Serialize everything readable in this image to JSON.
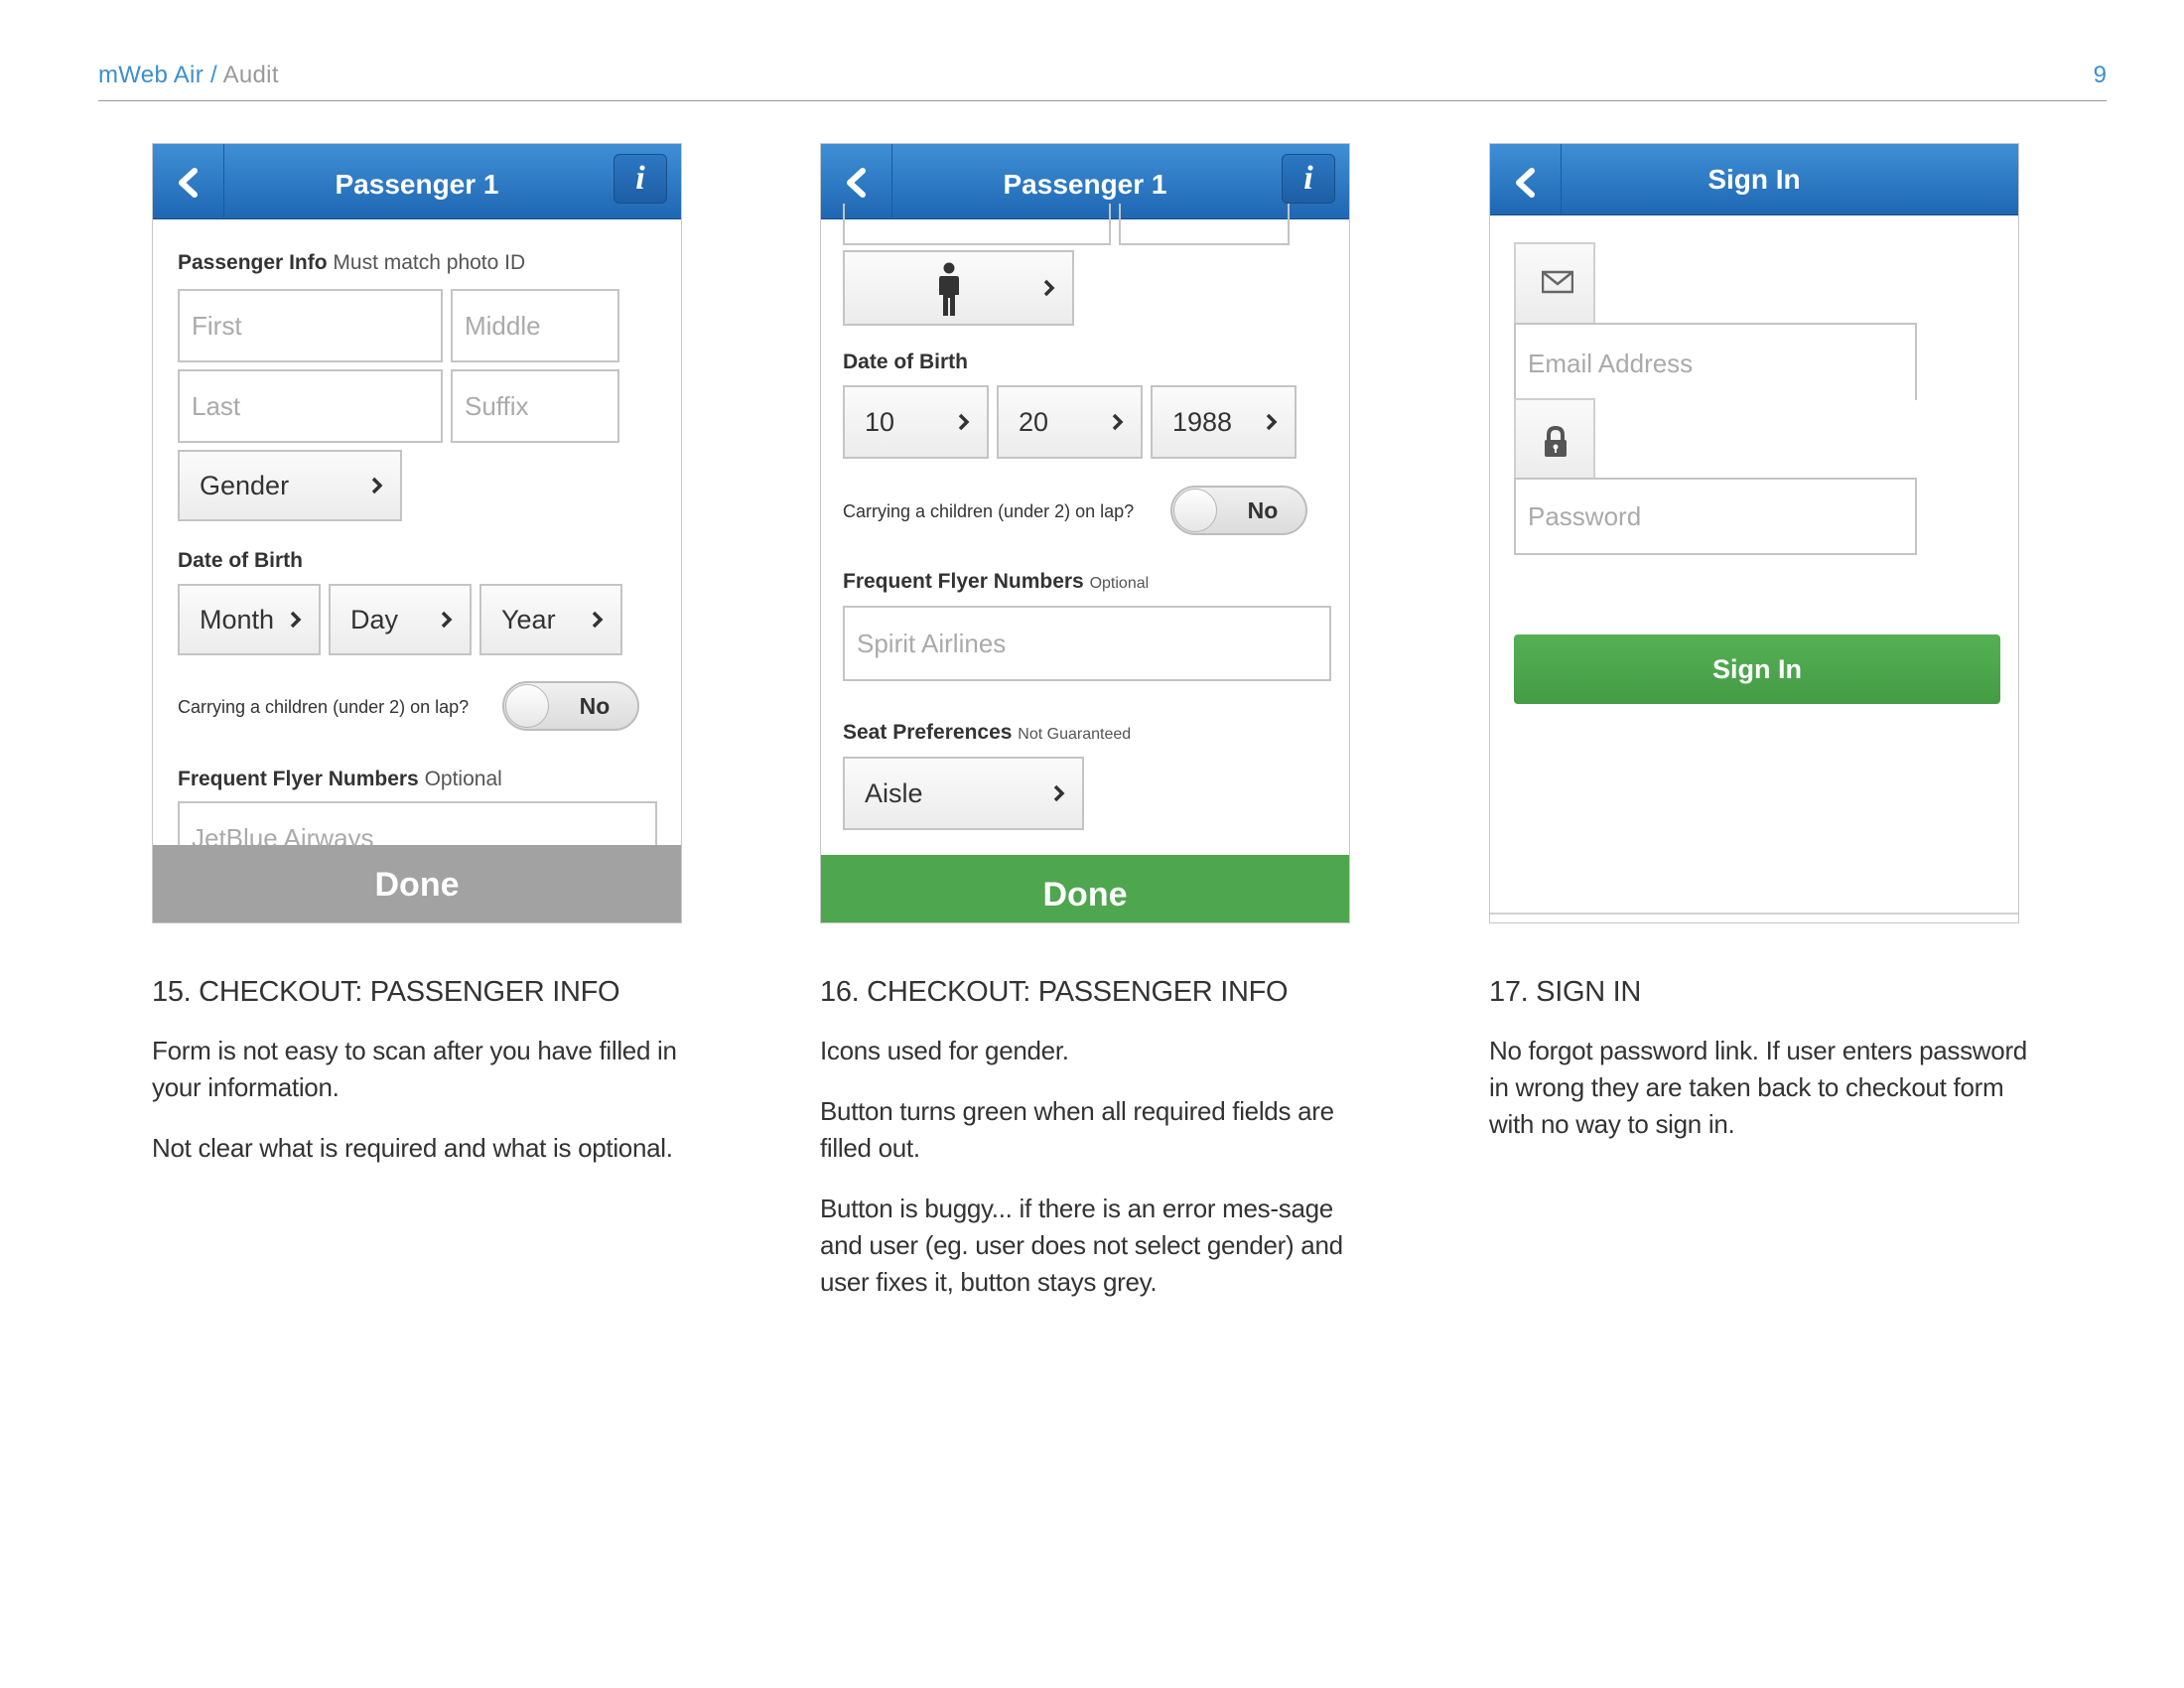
{
  "header": {
    "brand": "mWeb Air",
    "separator": " / ",
    "section": "Audit",
    "page_number": "9"
  },
  "screen1": {
    "title": "Passenger 1",
    "info_icon": "i",
    "passenger_info_label": "Passenger Info",
    "passenger_info_hint": "Must match photo ID",
    "first_placeholder": "First",
    "middle_placeholder": "Middle",
    "last_placeholder": "Last",
    "suffix_placeholder": "Suffix",
    "gender": "Gender",
    "dob_label": "Date of Birth",
    "month": "Month",
    "day": "Day",
    "year": "Year",
    "lap_question": "Carrying a children (under 2) on lap?",
    "lap_value": "No",
    "ff_label": "Frequent Flyer Numbers",
    "ff_hint": "Optional",
    "ff_placeholder": "JetBlue Airways",
    "done": "Done"
  },
  "screen2": {
    "title": "Passenger 1",
    "info_icon": "i",
    "gender_icon": "person-icon",
    "dob_label": "Date of Birth",
    "month": "10",
    "day": "20",
    "year": "1988",
    "lap_question": "Carrying a children (under 2) on lap?",
    "lap_value": "No",
    "ff_label": "Frequent Flyer Numbers",
    "ff_hint": "Optional",
    "ff_placeholder": "Spirit Airlines",
    "seat_label": "Seat Preferences",
    "seat_hint": "Not Guaranteed",
    "seat_value": "Aisle",
    "done": "Done"
  },
  "screen3": {
    "title": "Sign In",
    "email_icon": "envelope-icon",
    "email_placeholder": "Email Address",
    "password_icon": "lock-icon",
    "password_placeholder": "Password",
    "signin_button": "Sign In"
  },
  "captions": [
    {
      "heading": "15. CHECKOUT: PASSENGER INFO",
      "paragraphs": [
        "Form is not easy to scan after you have filled in your information.",
        "Not clear what is required and what is optional."
      ]
    },
    {
      "heading": "16. CHECKOUT: PASSENGER INFO",
      "paragraphs": [
        "Icons used for gender.",
        "Button turns green when all required fields are filled out.",
        "Button is buggy... if there is an error mes-sage and user (eg. user does not select gender) and user fixes it, button stays grey."
      ]
    },
    {
      "heading": "17. SIGN IN",
      "paragraphs": [
        "No forgot password link. If user enters password in wrong they are taken back to checkout form with no way to sign in."
      ]
    }
  ],
  "colors": {
    "accent_blue": "#2b7cc8",
    "done_grey": "#a2a2a2",
    "done_green": "#4ea64e",
    "header_link": "#3b8fd0"
  }
}
